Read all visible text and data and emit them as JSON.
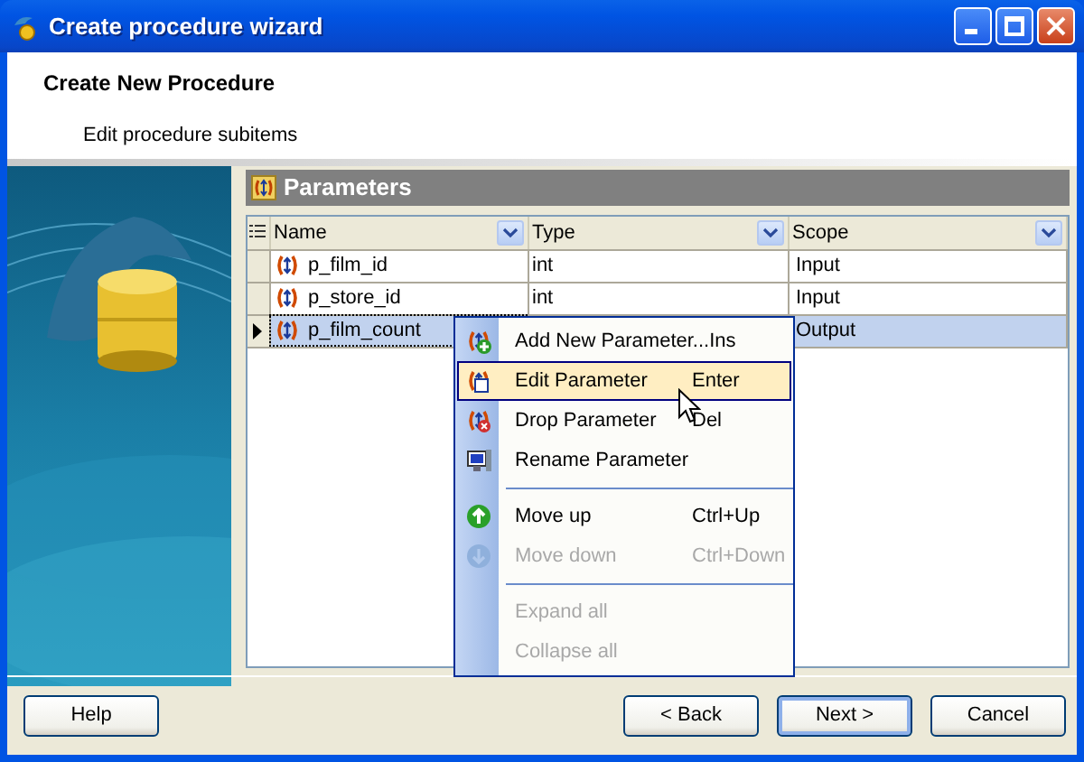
{
  "window": {
    "title": "Create procedure wizard"
  },
  "header": {
    "title": "Create New Procedure",
    "subtitle": "Edit procedure subitems"
  },
  "panel": {
    "title": "Parameters"
  },
  "grid": {
    "columns": [
      "Name",
      "Type",
      "Scope"
    ],
    "rows": [
      {
        "name": "p_film_id",
        "type": "int",
        "scope": "Input",
        "selected": false
      },
      {
        "name": "p_store_id",
        "type": "int",
        "scope": "Input",
        "selected": false
      },
      {
        "name": "p_film_count",
        "scope": "Output",
        "selected": true
      }
    ]
  },
  "context_menu": {
    "items": [
      {
        "kind": "item",
        "label": "Add New Parameter...",
        "shortcut": "Ins",
        "disabled": false,
        "selected": false
      },
      {
        "kind": "item",
        "label": "Edit Parameter",
        "shortcut": "Enter",
        "disabled": false,
        "selected": true
      },
      {
        "kind": "item",
        "label": "Drop Parameter",
        "shortcut": "Del",
        "disabled": false,
        "selected": false
      },
      {
        "kind": "item",
        "label": "Rename Parameter",
        "disabled": false,
        "selected": false
      },
      {
        "kind": "separator"
      },
      {
        "kind": "item",
        "label": "Move up",
        "shortcut": "Ctrl+Up",
        "disabled": false,
        "selected": false
      },
      {
        "kind": "item",
        "label": "Move down",
        "shortcut": "Ctrl+Down",
        "disabled": true,
        "selected": false
      },
      {
        "kind": "separator"
      },
      {
        "kind": "item",
        "label": "Expand all",
        "disabled": true,
        "selected": false
      },
      {
        "kind": "item",
        "label": "Collapse all",
        "disabled": true,
        "selected": false
      }
    ]
  },
  "buttons": [
    {
      "label": "Help",
      "default": false
    },
    {
      "label": "< Back",
      "default": false
    },
    {
      "label": "Next >",
      "default": true
    },
    {
      "label": "Cancel",
      "default": false
    }
  ]
}
